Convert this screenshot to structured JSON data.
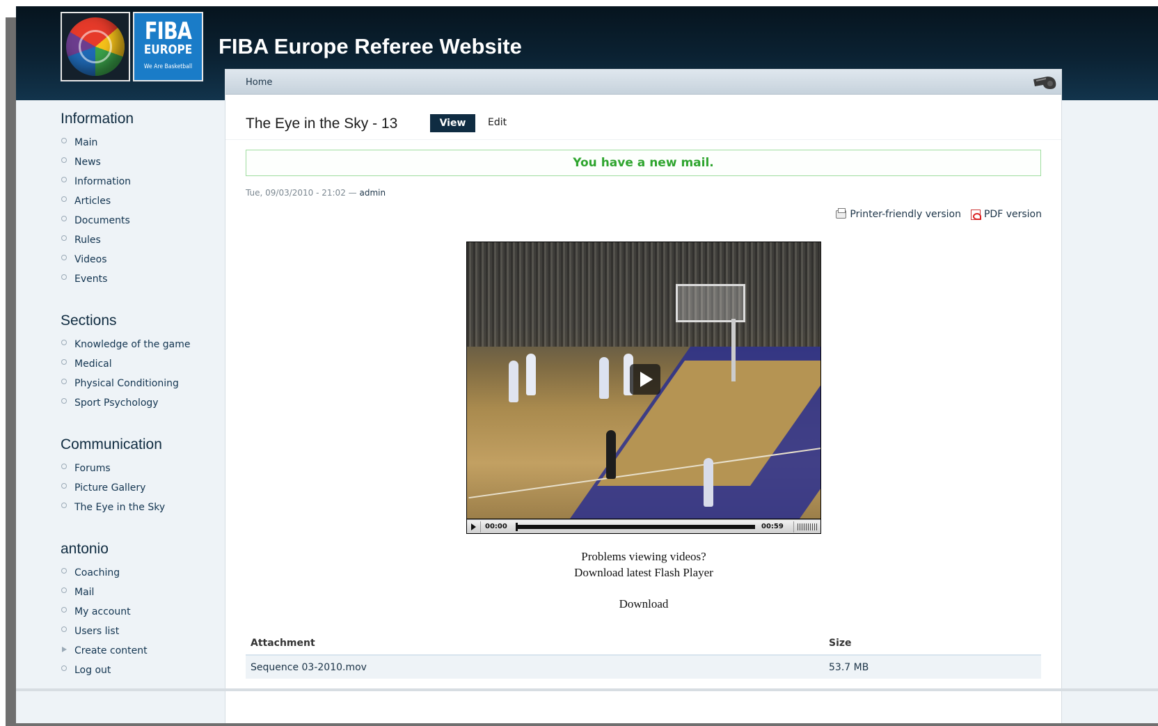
{
  "site": {
    "title": "FIBA Europe Referee Website",
    "logo": {
      "line1": "FIBA",
      "line2": "EUROPE",
      "tagline": "We Are Basketball"
    }
  },
  "breadcrumb": {
    "home": "Home"
  },
  "sidebar": {
    "blocks": [
      {
        "title": "Information",
        "items": [
          "Main",
          "News",
          "Information",
          "Articles",
          "Documents",
          "Rules",
          "Videos",
          "Events"
        ]
      },
      {
        "title": "Sections",
        "items": [
          "Knowledge of the game",
          "Medical",
          "Physical Conditioning",
          "Sport Psychology"
        ]
      },
      {
        "title": "Communication",
        "items": [
          "Forums",
          "Picture Gallery",
          "The Eye in the Sky"
        ]
      },
      {
        "title": "antonio",
        "items": [
          "Coaching",
          "Mail",
          "My account",
          "Users list",
          "Create content",
          "Log out"
        ]
      }
    ]
  },
  "page": {
    "title": "The Eye in the Sky - 13",
    "tabs": {
      "view": "View",
      "edit": "Edit"
    },
    "message": "You have a new mail.",
    "meta": {
      "date": "Tue, 09/03/2010 - 21:02",
      "separator": "—",
      "author": "admin"
    },
    "links": {
      "printer": "Printer-friendly version",
      "pdf": "PDF version"
    }
  },
  "video": {
    "time_start": "00:00",
    "time_end": "00:59",
    "problems": "Problems viewing videos?",
    "flash": "Download latest Flash Player",
    "download": "Download"
  },
  "attachments": {
    "headers": {
      "name": "Attachment",
      "size": "Size"
    },
    "rows": [
      {
        "name": "Sequence 03-2010.mov",
        "size": "53.7 MB"
      }
    ]
  }
}
